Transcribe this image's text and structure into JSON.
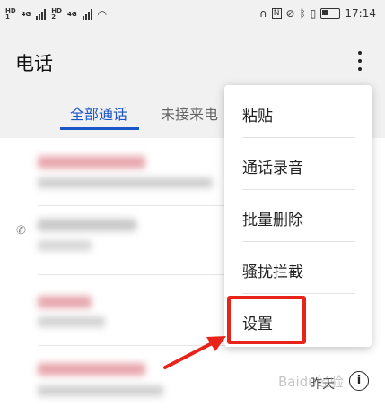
{
  "status_bar": {
    "left_badges": [
      "HD 1",
      "4G",
      "HD 2",
      "4G"
    ],
    "time": "17:14"
  },
  "header": {
    "title": "电话"
  },
  "tabs": [
    {
      "label": "全部通话",
      "active": true
    },
    {
      "label": "未接来电",
      "active": false
    }
  ],
  "list": {
    "last_row_time": "昨天"
  },
  "menu": {
    "items": [
      {
        "label": "粘贴"
      },
      {
        "label": "通话录音"
      },
      {
        "label": "批量删除"
      },
      {
        "label": "骚扰拦截"
      },
      {
        "label": "设置"
      }
    ]
  },
  "annotation": {
    "highlight_color": "#e8231a"
  },
  "colors": {
    "accent": "#1a56c8"
  },
  "watermark": "Baidu经验"
}
